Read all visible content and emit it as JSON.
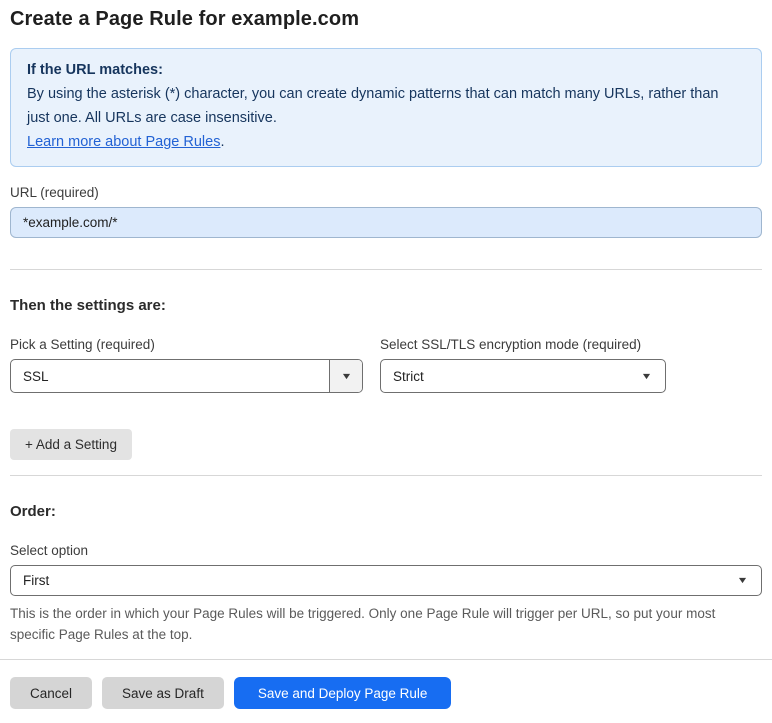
{
  "page": {
    "title": "Create a Page Rule for example.com"
  },
  "info_box": {
    "heading": "If the URL matches:",
    "body": "By using the asterisk (*) character, you can create dynamic patterns that can match many URLs, rather than just one. All URLs are case insensitive.",
    "link_label": "Learn more about Page Rules",
    "link_suffix": "."
  },
  "url_field": {
    "label": "URL (required)",
    "value": "*example.com/*"
  },
  "settings_section": {
    "heading": "Then the settings are:",
    "setting_picker": {
      "label": "Pick a Setting (required)",
      "selected": "SSL"
    },
    "ssl_mode_picker": {
      "label": "Select SSL/TLS encryption mode (required)",
      "selected": "Strict"
    },
    "add_setting_label": "+ Add a Setting"
  },
  "order_section": {
    "heading": "Order:",
    "select_label": "Select option",
    "selected": "First",
    "help_text": "This is the order in which your Page Rules will be triggered. Only one Page Rule will trigger per URL, so put your most specific Page Rules at the top."
  },
  "footer": {
    "cancel_label": "Cancel",
    "save_draft_label": "Save as Draft",
    "save_deploy_label": "Save and Deploy Page Rule"
  },
  "icons": {
    "dropdown_arrow": "▼"
  },
  "colors": {
    "accent_blue": "#176df2",
    "link_blue": "#2262d4",
    "info_background": "#e9f2fc",
    "info_border": "#abcdf0",
    "info_text": "#16355d",
    "url_input_background": "#dceafc",
    "button_gray": "#d5d5d5"
  }
}
